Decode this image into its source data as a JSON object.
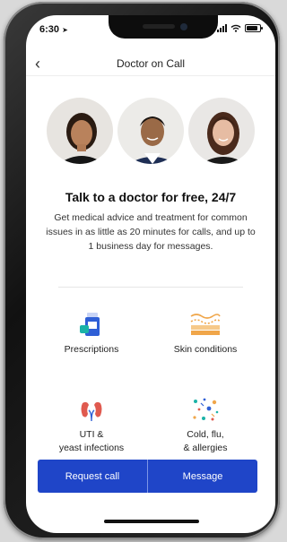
{
  "status_bar": {
    "time": "6:30",
    "location_arrow": "location-arrow-icon",
    "battery_level": 0.85
  },
  "nav": {
    "title": "Doctor on Call",
    "back_icon": "chevron-left-icon"
  },
  "hero": {
    "headline": "Talk to a doctor for free, 24/7",
    "description": "Get medical advice and treatment for common issues in as little as 20 minutes for calls, and up to 1 business day for messages."
  },
  "services": [
    {
      "label": "Prescriptions",
      "icon": "prescription-icon"
    },
    {
      "label": "Skin conditions",
      "icon": "skin-layers-icon"
    },
    {
      "label_line1": "UTI &",
      "label_line2": "yeast infections",
      "icon": "kidney-icon"
    },
    {
      "label_line1": "Cold, flu,",
      "label_line2": "& allergies",
      "icon": "virus-particles-icon"
    }
  ],
  "actions": {
    "request_call": "Request call",
    "message": "Message"
  },
  "colors": {
    "accent": "#1f45c8",
    "icon_blue": "#2f5fd6",
    "icon_orange": "#f0a64a",
    "icon_red": "#e05a4f",
    "icon_teal": "#1bb3a8"
  }
}
